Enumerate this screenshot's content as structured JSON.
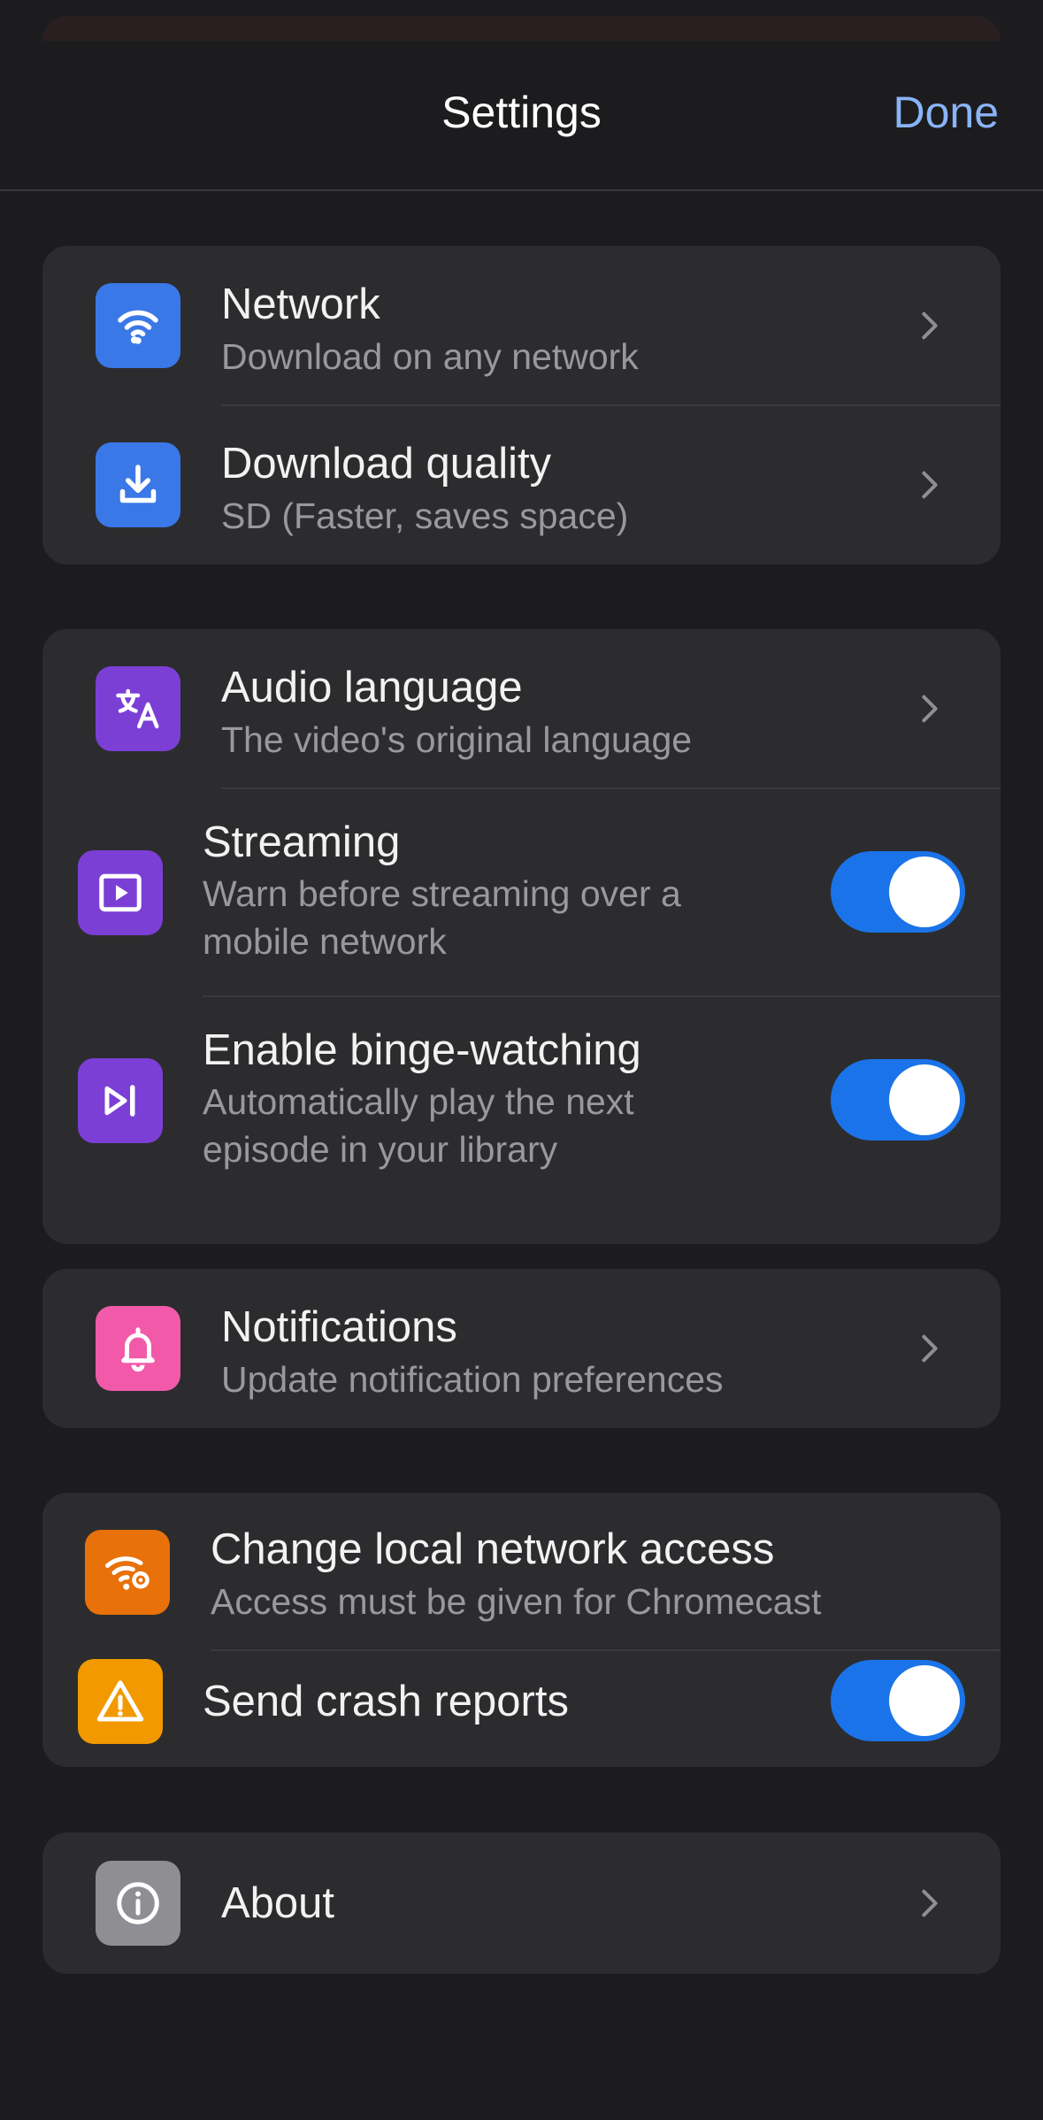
{
  "header": {
    "title": "Settings",
    "done_label": "Done"
  },
  "groups": {
    "downloads": {
      "network": {
        "label": "Network",
        "sub": "Download on any network",
        "icon": "wifi-icon",
        "color": "#3b78e7"
      },
      "quality": {
        "label": "Download quality",
        "sub": "SD (Faster, saves space)",
        "icon": "download-icon",
        "color": "#3b78e7"
      }
    },
    "playback": {
      "audio": {
        "label": "Audio language",
        "sub": "The video's original language",
        "icon": "translate-icon",
        "color": "#7b3fd6"
      },
      "streaming": {
        "label": "Streaming",
        "sub": "Warn before streaming over a mobile network",
        "icon": "play-icon",
        "color": "#7b3fd6",
        "enabled": true
      },
      "binge": {
        "label": "Enable binge-watching",
        "sub": "Automatically play the next episode in your library",
        "icon": "skip-next-icon",
        "color": "#7b3fd6",
        "enabled": true
      }
    },
    "notifications": {
      "notifications": {
        "label": "Notifications",
        "sub": "Update notification preferences",
        "icon": "bell-icon",
        "color": "#f25aa9"
      }
    },
    "system": {
      "local_network": {
        "label": "Change local network access",
        "sub": "Access must be given for Chromecast",
        "icon": "wifi-settings-icon",
        "color": "#e8710a"
      },
      "crash": {
        "label": "Send crash reports",
        "icon": "warning-icon",
        "color": "#f29900",
        "enabled": true
      }
    },
    "about": {
      "about": {
        "label": "About",
        "icon": "info-icon",
        "color": "#8e8e93"
      }
    }
  },
  "colors": {
    "toggle_on": "#1a73e8",
    "accent": "#8ab4f8"
  }
}
